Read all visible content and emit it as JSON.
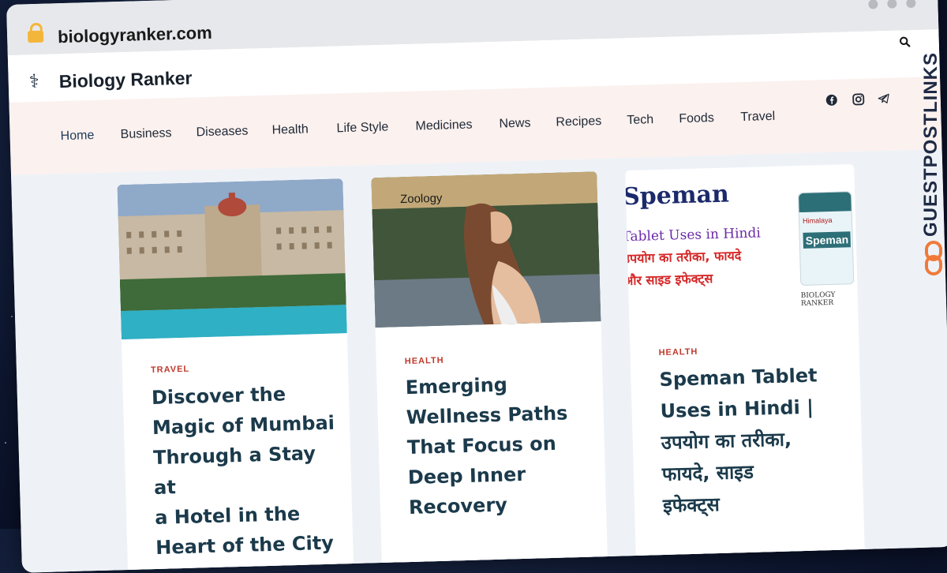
{
  "browser": {
    "url": "biologyranker.com"
  },
  "site": {
    "name": "Biology Ranker",
    "logo_icon": "caduceus-icon"
  },
  "nav": {
    "items": [
      "Home",
      "Business",
      "Diseases",
      "Health",
      "Life Style",
      "Medicines",
      "News",
      "Recipes",
      "Tech",
      "Foods",
      "Travel"
    ],
    "active": "Home"
  },
  "social_icons": [
    "facebook-icon",
    "instagram-icon",
    "telegram-icon"
  ],
  "cards": [
    {
      "category": "TRAVEL",
      "title_lines": [
        "Discover the",
        "Magic of Mumbai",
        "Through a Stay at",
        "a Hotel in the",
        "Heart of the City"
      ]
    },
    {
      "overlay_label": "Zoology",
      "category": "HEALTH",
      "title_lines": [
        "Emerging",
        "Wellness Paths",
        "That Focus on",
        "Deep Inner",
        "Recovery"
      ]
    },
    {
      "image_text": {
        "brand": "Speman",
        "line1": "Tablet Uses in Hindi",
        "line2": "उपयोग का तरीका, फायदे",
        "line3": "और साइड इफेक्ट्स",
        "bottle_brand": "Himalaya",
        "bottle_name": "Speman",
        "watermark": "BIOLOGY RANKER"
      },
      "category": "HEALTH",
      "title_lines": [
        "Speman Tablet",
        "Uses in Hindi |",
        "उपयोग का तरीका,",
        "फायदे, साइड",
        "इफेक्ट्स"
      ]
    }
  ],
  "watermark": {
    "text": "GUESTPOSTLINKS"
  },
  "colors": {
    "category": "#c0392b",
    "title": "#1b3a4b",
    "nav_bg": "#fbf1ee",
    "content_bg": "#eef2f7"
  }
}
